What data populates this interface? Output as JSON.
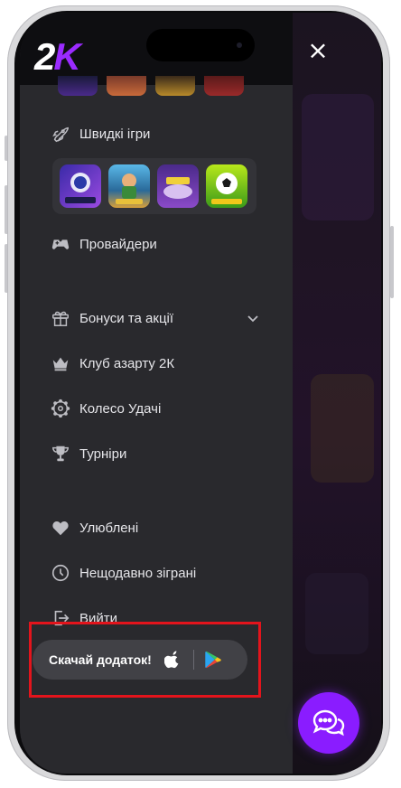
{
  "header": {
    "logo_two": "2",
    "logo_k": "K",
    "close_symbol": "×"
  },
  "menu": {
    "items": [
      {
        "label": "Швидкі ігри",
        "icon": "rocket-icon"
      },
      {
        "label": "Провайдери",
        "icon": "gamepad-icon"
      },
      {
        "label": "Бонуси та акції",
        "icon": "gift-icon",
        "expandable": true
      },
      {
        "label": "Клуб азарту 2К",
        "icon": "crown-icon"
      },
      {
        "label": "Колесо Удачі",
        "icon": "wheel-icon"
      },
      {
        "label": "Турніри",
        "icon": "trophy-icon"
      },
      {
        "label": "Улюблені",
        "icon": "heart-icon"
      },
      {
        "label": "Нещодавно зіграні",
        "icon": "clock-icon"
      },
      {
        "label": "Вийти",
        "icon": "logout-icon"
      }
    ]
  },
  "quick_games": [
    {
      "name": "SPACEMAN",
      "color": "#5a2fb8"
    },
    {
      "name": "",
      "color": "#2d7fb5"
    },
    {
      "name": "",
      "color": "#6b3aa8"
    },
    {
      "name": "",
      "color": "#c8d41a"
    }
  ],
  "app_download": {
    "label": "Скачай додаток!",
    "icons": [
      "apple-icon",
      "google-play-icon"
    ]
  },
  "colors": {
    "accent": "#9b2bff",
    "highlight_border": "#e3141c",
    "menu_bg": "#29292d",
    "chat_button": "#8a1cff"
  }
}
